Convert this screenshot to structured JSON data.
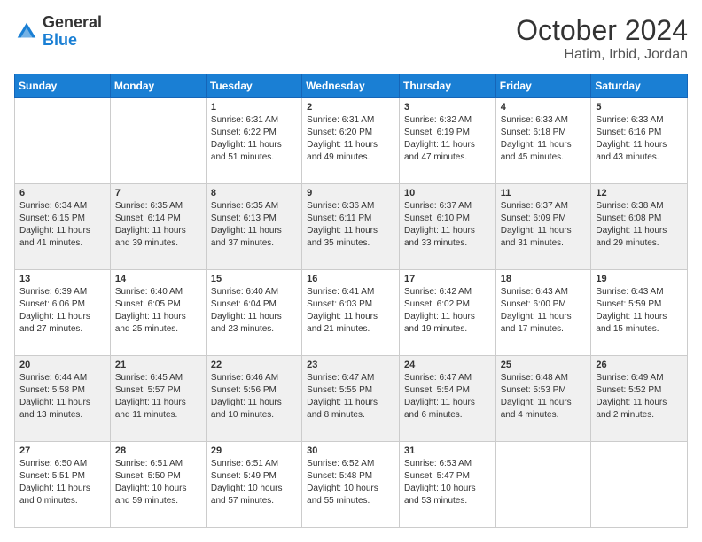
{
  "header": {
    "logo_general": "General",
    "logo_blue": "Blue",
    "month_title": "October 2024",
    "location": "Hatim, Irbid, Jordan"
  },
  "days_of_week": [
    "Sunday",
    "Monday",
    "Tuesday",
    "Wednesday",
    "Thursday",
    "Friday",
    "Saturday"
  ],
  "weeks": [
    [
      {
        "num": "",
        "sunrise": "",
        "sunset": "",
        "daylight": ""
      },
      {
        "num": "",
        "sunrise": "",
        "sunset": "",
        "daylight": ""
      },
      {
        "num": "1",
        "sunrise": "Sunrise: 6:31 AM",
        "sunset": "Sunset: 6:22 PM",
        "daylight": "Daylight: 11 hours and 51 minutes."
      },
      {
        "num": "2",
        "sunrise": "Sunrise: 6:31 AM",
        "sunset": "Sunset: 6:20 PM",
        "daylight": "Daylight: 11 hours and 49 minutes."
      },
      {
        "num": "3",
        "sunrise": "Sunrise: 6:32 AM",
        "sunset": "Sunset: 6:19 PM",
        "daylight": "Daylight: 11 hours and 47 minutes."
      },
      {
        "num": "4",
        "sunrise": "Sunrise: 6:33 AM",
        "sunset": "Sunset: 6:18 PM",
        "daylight": "Daylight: 11 hours and 45 minutes."
      },
      {
        "num": "5",
        "sunrise": "Sunrise: 6:33 AM",
        "sunset": "Sunset: 6:16 PM",
        "daylight": "Daylight: 11 hours and 43 minutes."
      }
    ],
    [
      {
        "num": "6",
        "sunrise": "Sunrise: 6:34 AM",
        "sunset": "Sunset: 6:15 PM",
        "daylight": "Daylight: 11 hours and 41 minutes."
      },
      {
        "num": "7",
        "sunrise": "Sunrise: 6:35 AM",
        "sunset": "Sunset: 6:14 PM",
        "daylight": "Daylight: 11 hours and 39 minutes."
      },
      {
        "num": "8",
        "sunrise": "Sunrise: 6:35 AM",
        "sunset": "Sunset: 6:13 PM",
        "daylight": "Daylight: 11 hours and 37 minutes."
      },
      {
        "num": "9",
        "sunrise": "Sunrise: 6:36 AM",
        "sunset": "Sunset: 6:11 PM",
        "daylight": "Daylight: 11 hours and 35 minutes."
      },
      {
        "num": "10",
        "sunrise": "Sunrise: 6:37 AM",
        "sunset": "Sunset: 6:10 PM",
        "daylight": "Daylight: 11 hours and 33 minutes."
      },
      {
        "num": "11",
        "sunrise": "Sunrise: 6:37 AM",
        "sunset": "Sunset: 6:09 PM",
        "daylight": "Daylight: 11 hours and 31 minutes."
      },
      {
        "num": "12",
        "sunrise": "Sunrise: 6:38 AM",
        "sunset": "Sunset: 6:08 PM",
        "daylight": "Daylight: 11 hours and 29 minutes."
      }
    ],
    [
      {
        "num": "13",
        "sunrise": "Sunrise: 6:39 AM",
        "sunset": "Sunset: 6:06 PM",
        "daylight": "Daylight: 11 hours and 27 minutes."
      },
      {
        "num": "14",
        "sunrise": "Sunrise: 6:40 AM",
        "sunset": "Sunset: 6:05 PM",
        "daylight": "Daylight: 11 hours and 25 minutes."
      },
      {
        "num": "15",
        "sunrise": "Sunrise: 6:40 AM",
        "sunset": "Sunset: 6:04 PM",
        "daylight": "Daylight: 11 hours and 23 minutes."
      },
      {
        "num": "16",
        "sunrise": "Sunrise: 6:41 AM",
        "sunset": "Sunset: 6:03 PM",
        "daylight": "Daylight: 11 hours and 21 minutes."
      },
      {
        "num": "17",
        "sunrise": "Sunrise: 6:42 AM",
        "sunset": "Sunset: 6:02 PM",
        "daylight": "Daylight: 11 hours and 19 minutes."
      },
      {
        "num": "18",
        "sunrise": "Sunrise: 6:43 AM",
        "sunset": "Sunset: 6:00 PM",
        "daylight": "Daylight: 11 hours and 17 minutes."
      },
      {
        "num": "19",
        "sunrise": "Sunrise: 6:43 AM",
        "sunset": "Sunset: 5:59 PM",
        "daylight": "Daylight: 11 hours and 15 minutes."
      }
    ],
    [
      {
        "num": "20",
        "sunrise": "Sunrise: 6:44 AM",
        "sunset": "Sunset: 5:58 PM",
        "daylight": "Daylight: 11 hours and 13 minutes."
      },
      {
        "num": "21",
        "sunrise": "Sunrise: 6:45 AM",
        "sunset": "Sunset: 5:57 PM",
        "daylight": "Daylight: 11 hours and 11 minutes."
      },
      {
        "num": "22",
        "sunrise": "Sunrise: 6:46 AM",
        "sunset": "Sunset: 5:56 PM",
        "daylight": "Daylight: 11 hours and 10 minutes."
      },
      {
        "num": "23",
        "sunrise": "Sunrise: 6:47 AM",
        "sunset": "Sunset: 5:55 PM",
        "daylight": "Daylight: 11 hours and 8 minutes."
      },
      {
        "num": "24",
        "sunrise": "Sunrise: 6:47 AM",
        "sunset": "Sunset: 5:54 PM",
        "daylight": "Daylight: 11 hours and 6 minutes."
      },
      {
        "num": "25",
        "sunrise": "Sunrise: 6:48 AM",
        "sunset": "Sunset: 5:53 PM",
        "daylight": "Daylight: 11 hours and 4 minutes."
      },
      {
        "num": "26",
        "sunrise": "Sunrise: 6:49 AM",
        "sunset": "Sunset: 5:52 PM",
        "daylight": "Daylight: 11 hours and 2 minutes."
      }
    ],
    [
      {
        "num": "27",
        "sunrise": "Sunrise: 6:50 AM",
        "sunset": "Sunset: 5:51 PM",
        "daylight": "Daylight: 11 hours and 0 minutes."
      },
      {
        "num": "28",
        "sunrise": "Sunrise: 6:51 AM",
        "sunset": "Sunset: 5:50 PM",
        "daylight": "Daylight: 10 hours and 59 minutes."
      },
      {
        "num": "29",
        "sunrise": "Sunrise: 6:51 AM",
        "sunset": "Sunset: 5:49 PM",
        "daylight": "Daylight: 10 hours and 57 minutes."
      },
      {
        "num": "30",
        "sunrise": "Sunrise: 6:52 AM",
        "sunset": "Sunset: 5:48 PM",
        "daylight": "Daylight: 10 hours and 55 minutes."
      },
      {
        "num": "31",
        "sunrise": "Sunrise: 6:53 AM",
        "sunset": "Sunset: 5:47 PM",
        "daylight": "Daylight: 10 hours and 53 minutes."
      },
      {
        "num": "",
        "sunrise": "",
        "sunset": "",
        "daylight": ""
      },
      {
        "num": "",
        "sunrise": "",
        "sunset": "",
        "daylight": ""
      }
    ]
  ]
}
